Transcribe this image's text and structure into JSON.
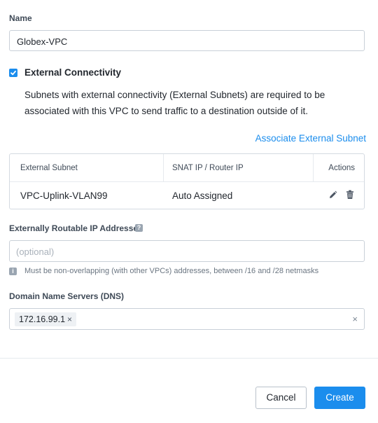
{
  "form": {
    "name_label": "Name",
    "name_value": "Globex-VPC",
    "external_connectivity": {
      "label": "External Connectivity",
      "checked": true,
      "description": "Subnets with external connectivity (External Subnets) are required to be associated with this VPC to send traffic to a destination outside of it.",
      "associate_link": "Associate External Subnet"
    },
    "subnet_table": {
      "columns": [
        "External Subnet",
        "SNAT IP / Router IP",
        "Actions"
      ],
      "rows": [
        {
          "subnet": "VPC-Uplink-VLAN99",
          "snat": "Auto Assigned"
        }
      ]
    },
    "routable_ips": {
      "label": "Externally Routable IP Addresses",
      "help_icon": "?",
      "placeholder": "(optional)",
      "info_icon": "i",
      "hint": "Must be non-overlapping (with other VPCs) addresses, between /16 and /28 netmasks"
    },
    "dns": {
      "label": "Domain Name Servers (DNS)",
      "tags": [
        "172.16.99.1"
      ],
      "tag_remove": "×",
      "clear": "×"
    }
  },
  "footer": {
    "cancel_label": "Cancel",
    "create_label": "Create"
  },
  "colors": {
    "accent": "#1b8ded",
    "text": "#22272e",
    "muted": "#6b7682",
    "border": "#c9d0d8"
  },
  "icons": [
    "checkbox-check-icon",
    "pencil-icon",
    "trash-icon",
    "help-icon",
    "info-icon",
    "close-icon"
  ]
}
